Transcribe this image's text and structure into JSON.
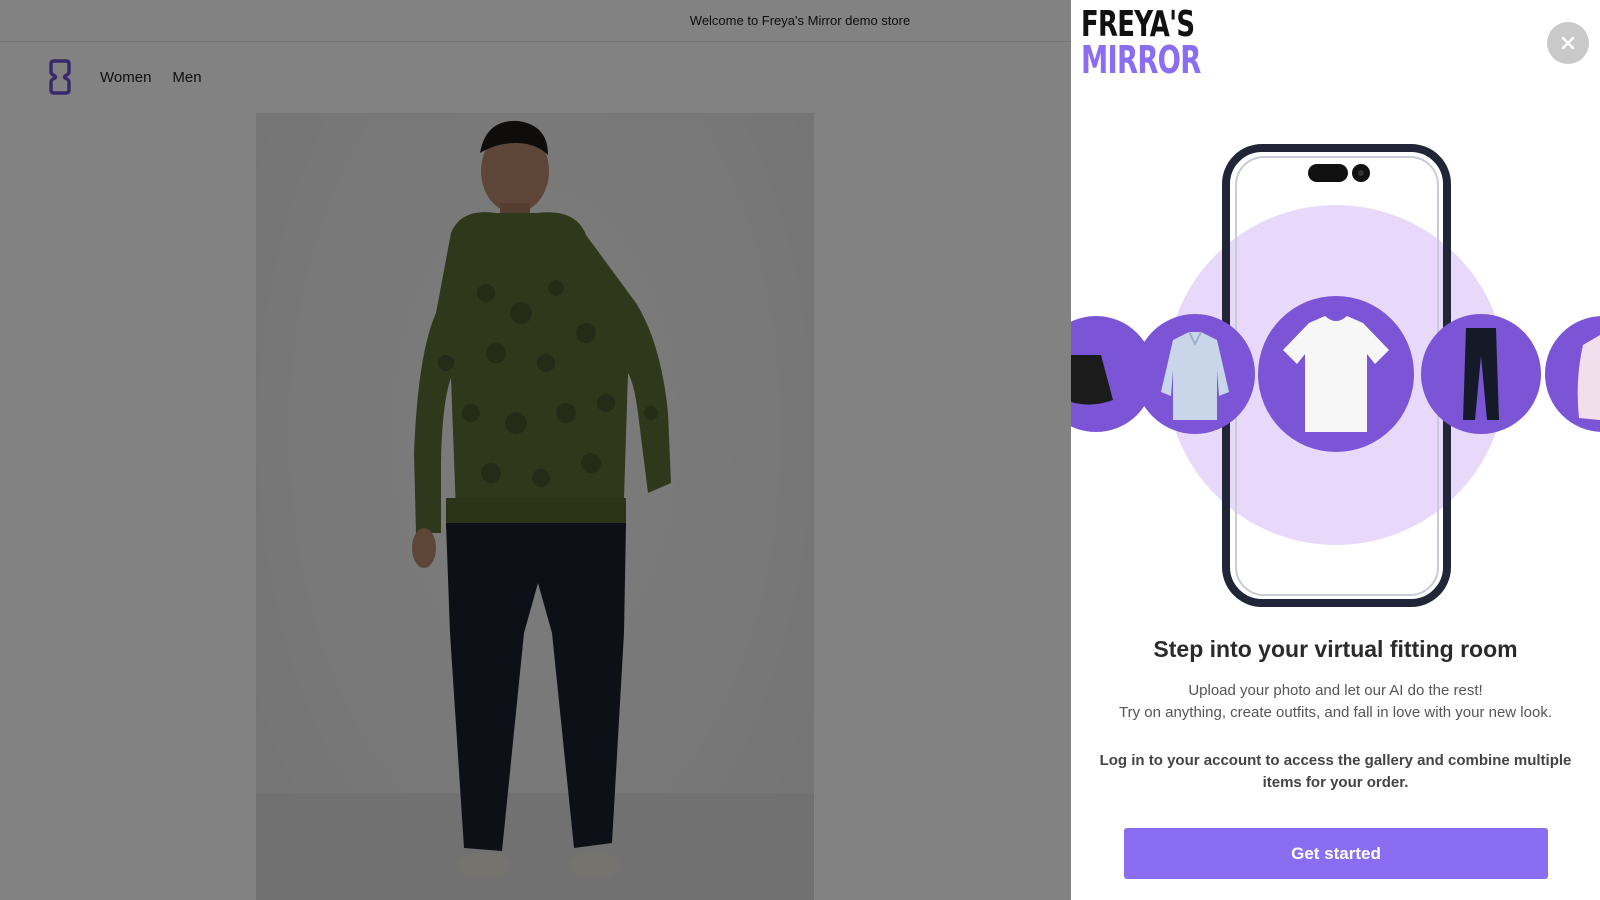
{
  "store": {
    "announcement": "Welcome to Freya's Mirror demo store",
    "nav": [
      {
        "label": "Women"
      },
      {
        "label": "Men"
      }
    ],
    "logo_icon": "store-logo-icon",
    "product_image": "model in green leopard hoodie and navy trousers"
  },
  "overlay_opacity": 0.49,
  "panel": {
    "brand": {
      "line1": "FREYA'S",
      "line2": "MIRROR"
    },
    "close_icon": "close-icon",
    "hero_items": [
      "black skirt",
      "blue shirt",
      "white t-shirt",
      "black trousers",
      "pink jacket"
    ],
    "headline": "Step into your virtual fitting room",
    "subtitle_line1": "Upload your photo and let our AI do the rest!",
    "subtitle_line2": "Try on anything, create outfits, and fall in love with your new look.",
    "login_note": "Log in to your account to access the gallery and combine multiple items for your order.",
    "cta_label": "Get started"
  },
  "colors": {
    "accent": "#8a6df0",
    "accent_light": "#e8d9fb",
    "circle_purple": "#7b55d6",
    "overlay": "#000000"
  }
}
